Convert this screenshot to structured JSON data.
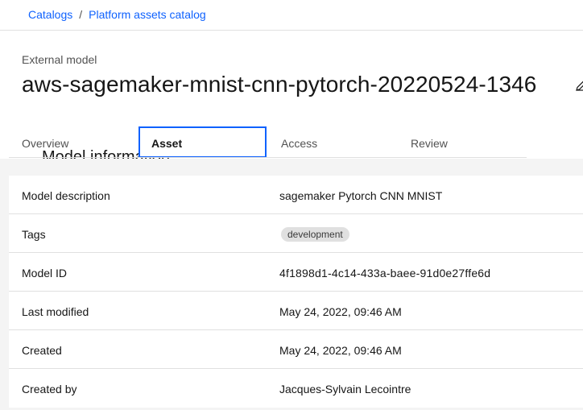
{
  "breadcrumb": {
    "items": [
      "Catalogs",
      "Platform assets catalog"
    ],
    "separator": "/"
  },
  "header": {
    "asset_type": "External model",
    "title": "aws-sagemaker-mnist-cnn-pytorch-20220524-1346",
    "edit_icon": "pencil-icon"
  },
  "tabs": [
    {
      "label": "Overview",
      "active": false
    },
    {
      "label": "Asset",
      "active": true
    },
    {
      "label": "Access",
      "active": false
    },
    {
      "label": "Review",
      "active": false
    }
  ],
  "section": {
    "title": "Model information"
  },
  "details": {
    "model_description": {
      "label": "Model description",
      "value": "sagemaker Pytorch CNN MNIST"
    },
    "tags": {
      "label": "Tags",
      "items": [
        "development"
      ]
    },
    "model_id": {
      "label": "Model ID",
      "value": "4f1898d1-4c14-433a-baee-91d0e27ffe6d"
    },
    "last_modified": {
      "label": "Last modified",
      "value": "May 24, 2022, 09:46 AM"
    },
    "created": {
      "label": "Created",
      "value": "May 24, 2022, 09:46 AM"
    },
    "created_by": {
      "label": "Created by",
      "value": "Jacques-Sylvain Lecointre"
    }
  },
  "colors": {
    "link": "#0f62fe",
    "focus": "#0f62fe",
    "tag_bg": "#e0e0e0",
    "page_bg": "#f4f4f4"
  }
}
